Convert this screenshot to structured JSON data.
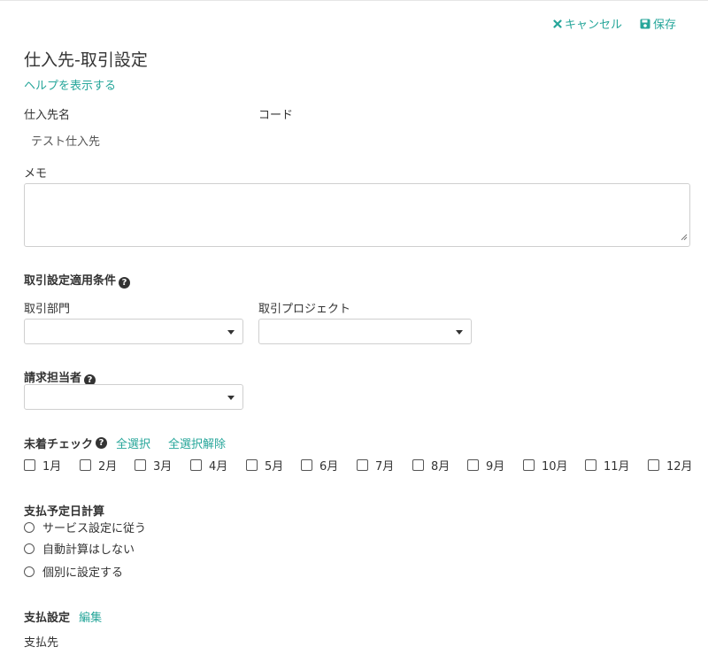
{
  "header": {
    "cancel_label": "キャンセル",
    "save_label": "保存",
    "title": "仕入先-取引設定",
    "help_link": "ヘルプを表示する"
  },
  "supplier": {
    "name_label": "仕入先名",
    "name_value": "テスト仕入先",
    "code_label": "コード"
  },
  "memo": {
    "label": "メモ",
    "value": ""
  },
  "conditions": {
    "heading": "取引設定適用条件",
    "department_label": "取引部門",
    "department_value": "",
    "project_label": "取引プロジェクト",
    "project_value": ""
  },
  "billing": {
    "label": "請求担当者",
    "value": ""
  },
  "uncollected_check": {
    "label": "未着チェック",
    "select_all": "全選択",
    "deselect_all": "全選択解除",
    "months": [
      "1月",
      "2月",
      "3月",
      "4月",
      "5月",
      "6月",
      "7月",
      "8月",
      "9月",
      "10月",
      "11月",
      "12月"
    ]
  },
  "payment_calc": {
    "heading": "支払予定日計算",
    "options": [
      "サービス設定に従う",
      "自動計算はしない",
      "個別に設定する"
    ]
  },
  "payment_settings": {
    "heading": "支払設定",
    "edit_link": "編集",
    "payee_label": "支払先"
  },
  "colors": {
    "accent": "#26a69a",
    "text": "#333333",
    "border": "#cfcfcf"
  }
}
